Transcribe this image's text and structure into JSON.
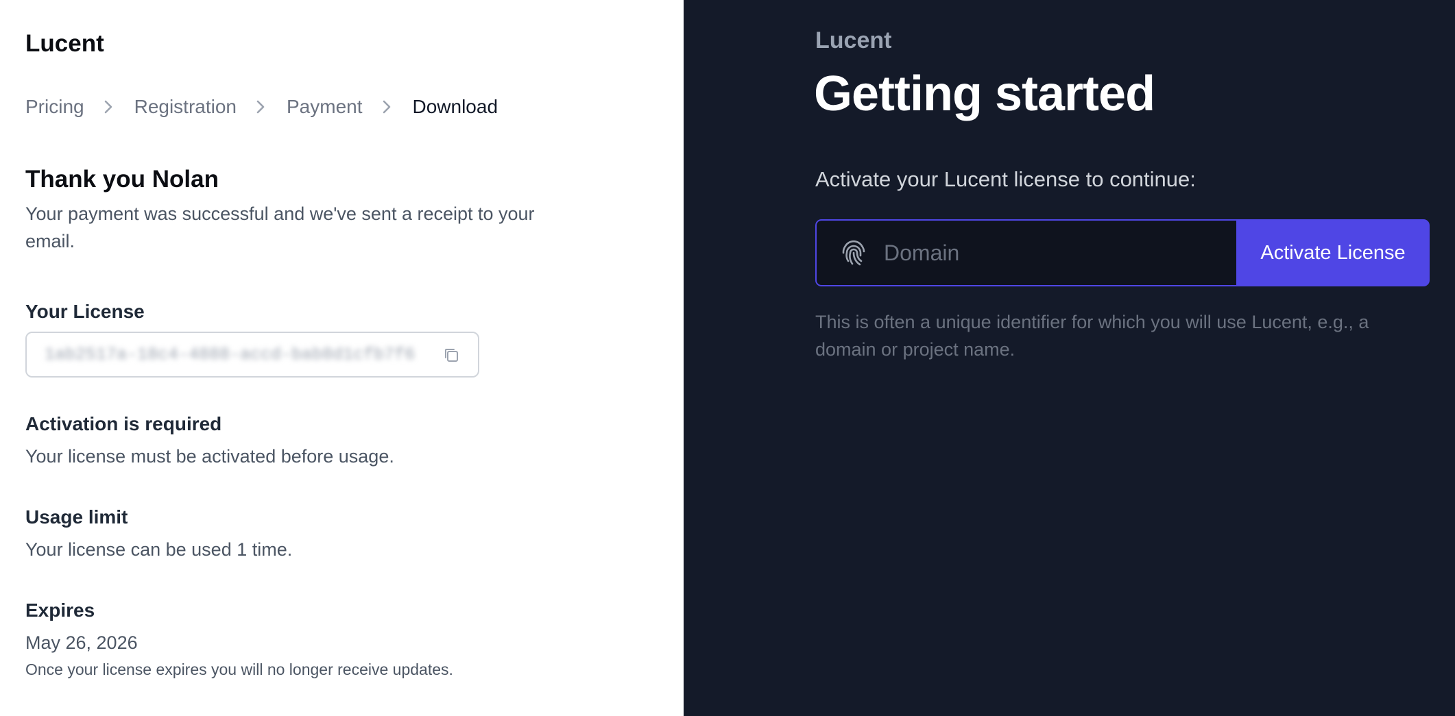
{
  "left": {
    "brand": "Lucent",
    "breadcrumb": [
      "Pricing",
      "Registration",
      "Payment",
      "Download"
    ],
    "thanks_title": "Thank you Nolan",
    "thanks_body": "Your payment was successful and we've sent a receipt to your email.",
    "license_label": "Your License",
    "license_key": "1ab2517a-18c4-4888-accd-bab8d1cfb7f6",
    "activation_label": "Activation is required",
    "activation_body": "Your license must be activated before usage.",
    "usage_label": "Usage limit",
    "usage_body": "Your license can be used 1 time.",
    "expires_label": "Expires",
    "expires_date": "May 26, 2026",
    "expires_note": "Once your license expires you will no longer receive updates."
  },
  "right": {
    "brand": "Lucent",
    "title": "Getting started",
    "subtitle": "Activate your Lucent license to continue:",
    "domain_placeholder": "Domain",
    "activate_button": "Activate License",
    "hint": "This is often a unique identifier for which you will use Lucent, e.g., a domain or project name."
  },
  "icons": {
    "chevron": "chevron-right-icon",
    "copy": "copy-icon",
    "fingerprint": "fingerprint-icon"
  },
  "colors": {
    "dark_panel": "#141a29",
    "accent": "#4f46e5",
    "text_muted": "#6b7280"
  }
}
